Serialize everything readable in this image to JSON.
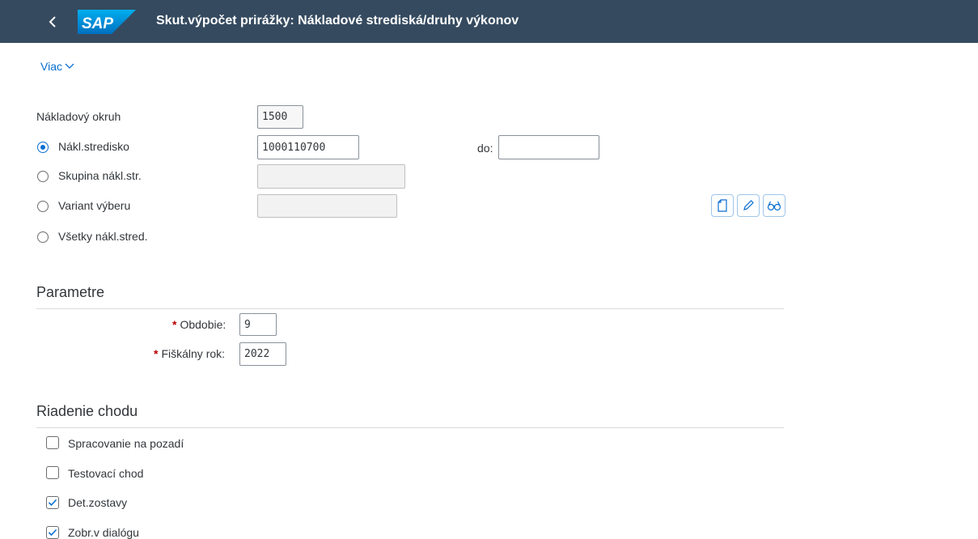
{
  "shell": {
    "logo": "SAP",
    "title": "Skut.výpočet prirážky: Nákladové strediská/druhy výkonov",
    "background": "#354a5f"
  },
  "toolbar": {
    "more_label": "Viac"
  },
  "selection": {
    "controlling_area_label": "Nákladový okruh",
    "controlling_area_value": "1500",
    "cost_center_label": "Nákl.stredisko",
    "cost_center_value": "1000110700",
    "to_label": "do:",
    "to_value": "",
    "cost_center_group_label": "Skupina nákl.str.",
    "cost_center_group_value": "",
    "selection_variant_label": "Variant výberu",
    "selection_variant_value": "",
    "all_cost_centers_label": "Všetky nákl.stred.",
    "selected_option": "cost_center"
  },
  "variant_tools": [
    "create-icon",
    "edit-icon",
    "display-icon"
  ],
  "parameters": {
    "title": "Parametre",
    "period_label": "Obdobie:",
    "period_value": "9",
    "fiscal_year_label": "Fiškálny rok:",
    "fiscal_year_value": "2022",
    "required_marker": "*"
  },
  "run_control": {
    "title": "Riadenie chodu",
    "items": [
      {
        "label": "Spracovanie na pozadí",
        "checked": false
      },
      {
        "label": "Testovací chod",
        "checked": false
      },
      {
        "label": "Det.zostavy",
        "checked": true
      },
      {
        "label": "Zobr.v dialógu",
        "checked": true
      }
    ]
  },
  "colors": {
    "accent": "#0a6ed1",
    "required": "#bb0000"
  }
}
